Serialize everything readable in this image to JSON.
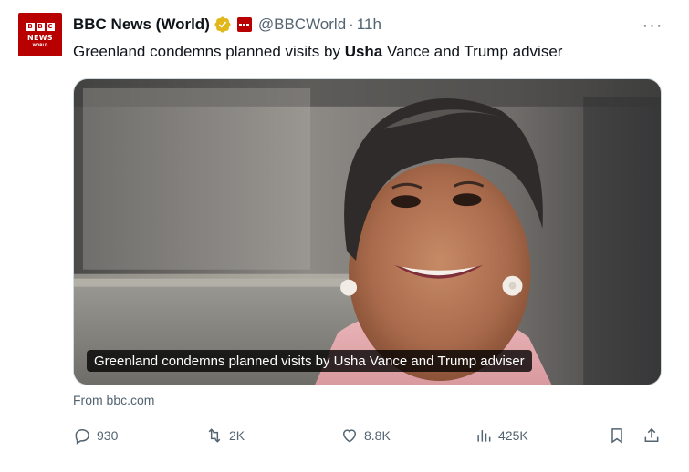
{
  "account": {
    "avatar_blocks": [
      "B",
      "B",
      "C"
    ],
    "avatar_news": "NEWS",
    "avatar_world": "WORLD",
    "display_name": "BBC News (World)",
    "verified_icon": "gold-verified-badge",
    "handle": "@BBCWorld",
    "separator": "·",
    "time": "11h",
    "more_label": "···"
  },
  "tweet": {
    "text_before": "Greenland condemns planned visits by ",
    "text_bold": "Usha",
    "text_after": " Vance and Trump adviser"
  },
  "card": {
    "caption": "Greenland condemns planned visits by Usha Vance and Trump adviser",
    "from": "From bbc.com"
  },
  "actions": {
    "replies": "930",
    "reposts": "2K",
    "likes": "8.8K",
    "views": "425K"
  },
  "colors": {
    "brand_red": "#b80000",
    "verified_gold": "#e2b719",
    "secondary_text": "#536471"
  }
}
